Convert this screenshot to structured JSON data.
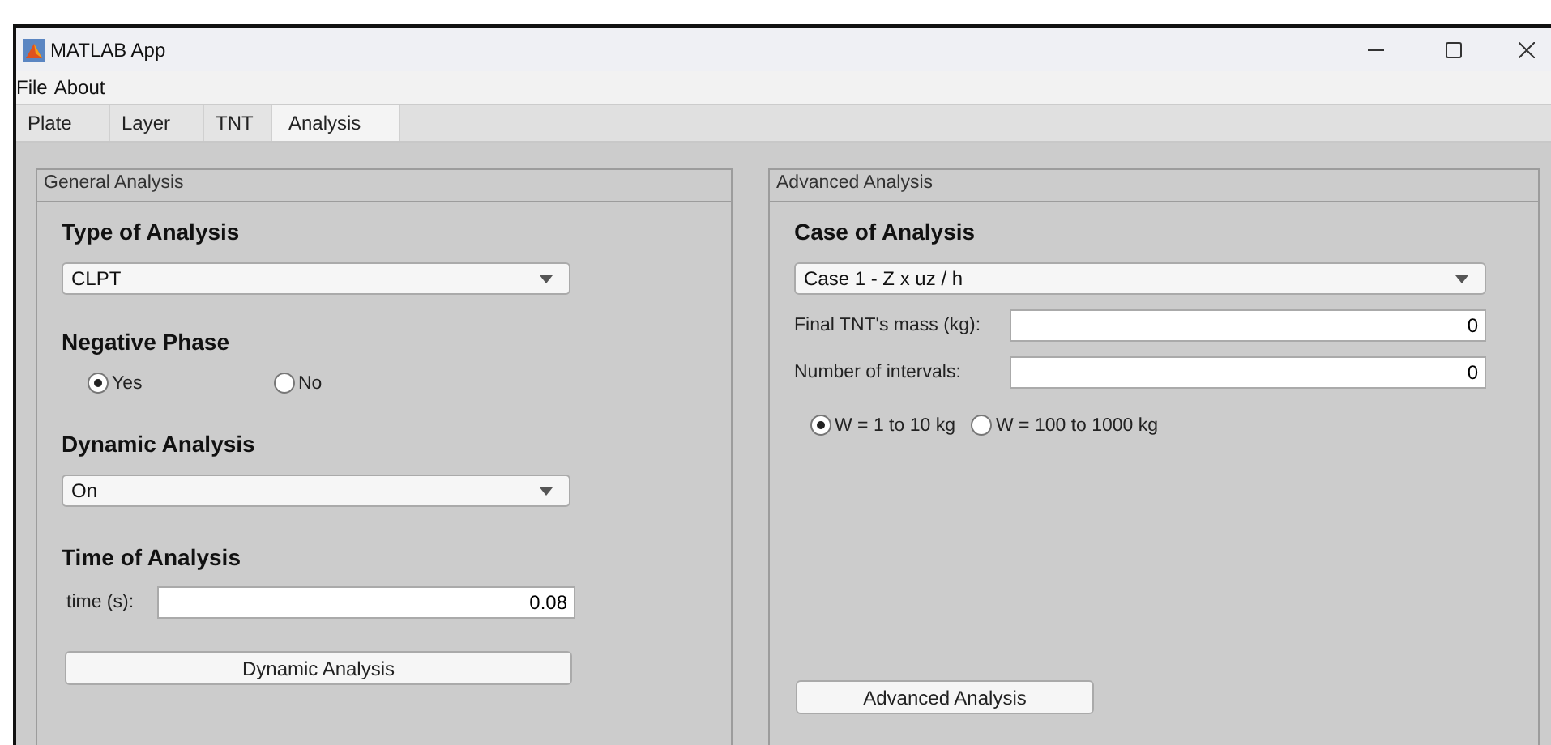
{
  "window": {
    "title": "MATLAB App"
  },
  "menu": [
    "File",
    "About"
  ],
  "tabs": [
    {
      "label": "Plate",
      "selected": false
    },
    {
      "label": "Layer",
      "selected": false
    },
    {
      "label": "TNT",
      "selected": false
    },
    {
      "label": "Analysis",
      "selected": true
    }
  ],
  "general_analysis": {
    "title": "General Analysis",
    "type_of_analysis": {
      "heading": "Type of Analysis",
      "value": "CLPT"
    },
    "negative_phase": {
      "heading": "Negative Phase",
      "options": [
        {
          "label": "Yes",
          "selected": true
        },
        {
          "label": "No",
          "selected": false
        }
      ]
    },
    "dynamic_analysis": {
      "heading": "Dynamic Analysis",
      "value": "On"
    },
    "time_of_analysis": {
      "heading": "Time of Analysis",
      "label": "time (s):",
      "value": "0.08"
    },
    "button": "Dynamic Analysis"
  },
  "advanced_analysis": {
    "title": "Advanced Analysis",
    "case_of_analysis": {
      "heading": "Case of Analysis",
      "value": "Case 1 - Z x uz / h"
    },
    "fields": [
      {
        "label": "Final TNT's mass (kg):",
        "value": "0"
      },
      {
        "label": "Number of intervals:",
        "value": "0"
      }
    ],
    "options": [
      {
        "label": "W = 1 to 10 kg",
        "selected": true
      },
      {
        "label": "W = 100 to 1000 kg",
        "selected": false
      }
    ],
    "button": "Advanced Analysis"
  }
}
